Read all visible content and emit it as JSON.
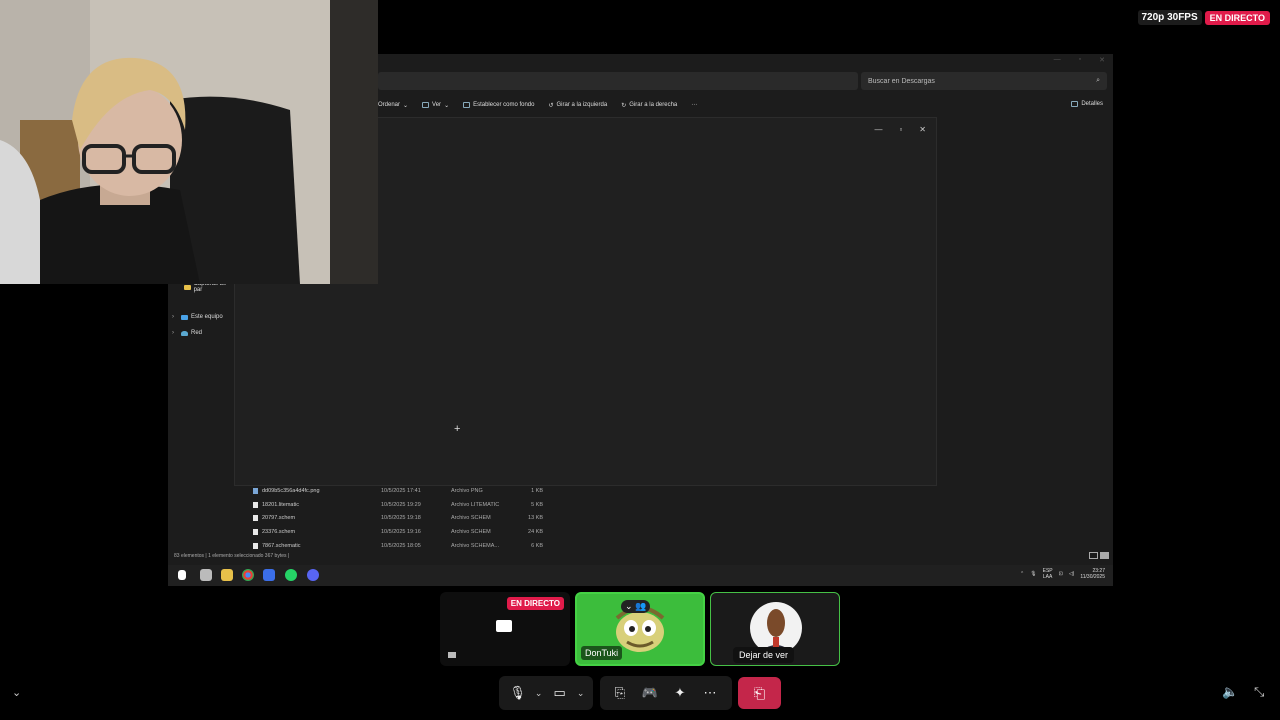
{
  "stream": {
    "quality": "720p 30FPS",
    "live": "EN DIRECTO"
  },
  "explorer": {
    "search_placeholder": "Buscar en Descargas",
    "toolbar": {
      "ordenar": "Ordenar",
      "ver": "Ver",
      "set_background": "Establecer como fondo",
      "rotate_left": "Girar a la izquierda",
      "rotate_right": "Girar a la derecha",
      "more": "···"
    },
    "details": "Detalles",
    "nav": {
      "folder": "Capturas de par",
      "this_pc": "Este equipo",
      "network": "Red"
    },
    "files": [
      {
        "name": "dd09b5c356a4d4fc.png",
        "date": "10/5/2025 17:41",
        "type": "Archivo PNG",
        "size": "1 KB"
      },
      {
        "name": "18201.litematic",
        "date": "10/5/2025 19:29",
        "type": "Archivo LITEMATIC",
        "size": "5 KB"
      },
      {
        "name": "20797.schem",
        "date": "10/5/2025 19:18",
        "type": "Archivo SCHEM",
        "size": "13 KB"
      },
      {
        "name": "23376.schem",
        "date": "10/5/2025 19:16",
        "type": "Archivo SCHEM",
        "size": "24 KB"
      },
      {
        "name": "7867.schematic",
        "date": "10/5/2025 18:05",
        "type": "Archivo SCHEMA...",
        "size": "6 KB"
      }
    ],
    "status": "83 elementos  |  1 elemento seleccionado  367 bytes  |"
  },
  "taskbar": {
    "lang_top": "ESP",
    "lang_bottom": "LAA",
    "time": "23:27",
    "date": "11/30/2025"
  },
  "call": {
    "screen_tile_live": "EN DIRECTO",
    "user_name": "DonTuki",
    "tooltip": "Dejar de ver"
  },
  "colors": {
    "live": "#e01b4a",
    "speaking_green": "#3cbd3c",
    "leave_red": "#c4264a"
  }
}
